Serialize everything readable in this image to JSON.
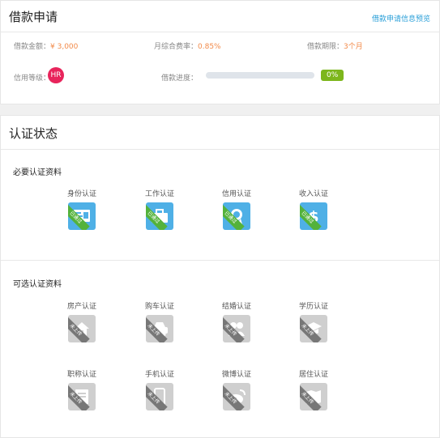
{
  "loan": {
    "title": "借款申请",
    "preview_link": "借款申请信息预览",
    "amount_label": "借款金额：",
    "amount_value": "¥ 3,000",
    "rate_label": "月综合费率：",
    "rate_value": "0.85%",
    "term_label": "借款期限：",
    "term_value": "3个月",
    "credit_label": "信用等级：",
    "credit_value": "HR",
    "progress_label": "借款进度：",
    "progress_text": "0%",
    "progress_fraction": 0,
    "colors": {
      "accent_orange": "#f28a49",
      "credit_badge": "#e8245b",
      "progress_green": "#7db61c",
      "link_blue": "#2a9fd8"
    }
  },
  "certification": {
    "title": "认证状态",
    "required_title": "必要认证资料",
    "optional_title": "可选认证资料",
    "required": [
      {
        "label": "身份认证",
        "icon": "id-card-icon",
        "status": "已通过"
      },
      {
        "label": "工作认证",
        "icon": "briefcase-icon",
        "status": "已通过"
      },
      {
        "label": "信用认证",
        "icon": "credit-medal-icon",
        "status": "已通过"
      },
      {
        "label": "收入认证",
        "icon": "dollar-icon",
        "status": "已通过"
      }
    ],
    "optional": [
      {
        "label": "房产认证",
        "icon": "house-icon",
        "status": "未上传"
      },
      {
        "label": "购车认证",
        "icon": "car-icon",
        "status": "未上传"
      },
      {
        "label": "结婚认证",
        "icon": "couple-icon",
        "status": "未上传"
      },
      {
        "label": "学历认证",
        "icon": "graduation-cap-icon",
        "status": "未上传"
      },
      {
        "label": "职称认证",
        "icon": "certificate-icon",
        "status": "未上传"
      },
      {
        "label": "手机认证",
        "icon": "phone-icon",
        "status": "未上传"
      },
      {
        "label": "微博认证",
        "icon": "weibo-icon",
        "status": "未上传"
      },
      {
        "label": "居住认证",
        "icon": "map-icon",
        "status": "未上传"
      }
    ],
    "colors": {
      "verified_icon_bg": "#4fb0e6",
      "verified_ribbon": "#54b23b",
      "pending_icon_bg": "#cfcfcf",
      "pending_ribbon": "#777777"
    }
  }
}
